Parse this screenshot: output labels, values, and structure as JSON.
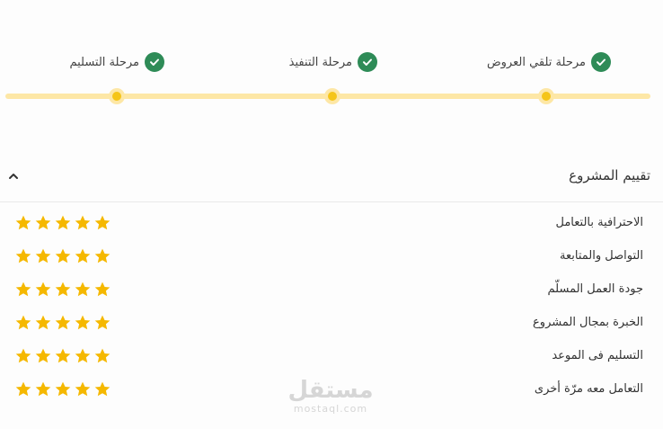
{
  "stages": [
    {
      "label": "مرحلة تلقي العروض",
      "completed": true
    },
    {
      "label": "مرحلة التنفيذ",
      "completed": true
    },
    {
      "label": "مرحلة التسليم",
      "completed": true
    }
  ],
  "rating": {
    "title": "تقييم المشروع",
    "criteria": [
      {
        "label": "الاحترافية بالتعامل",
        "stars": 5,
        "max": 5
      },
      {
        "label": "التواصل والمتابعة",
        "stars": 5,
        "max": 5
      },
      {
        "label": "جودة العمل المسلّم",
        "stars": 5,
        "max": 5
      },
      {
        "label": "الخبرة بمجال المشروع",
        "stars": 5,
        "max": 5
      },
      {
        "label": "التسليم فى الموعد",
        "stars": 5,
        "max": 5
      },
      {
        "label": "التعامل معه مرّة أخرى",
        "stars": 5,
        "max": 5
      }
    ]
  },
  "watermark": {
    "main": "مستقل",
    "sub": "mostaql.com"
  },
  "colors": {
    "check": "#2e8b57",
    "track": "#fde7a6",
    "dot": "#f5c518",
    "star": "#f5b800"
  },
  "icons": {
    "stage": "check-circle-icon",
    "collapse": "chevron-up-icon",
    "rating": "star-icon"
  }
}
